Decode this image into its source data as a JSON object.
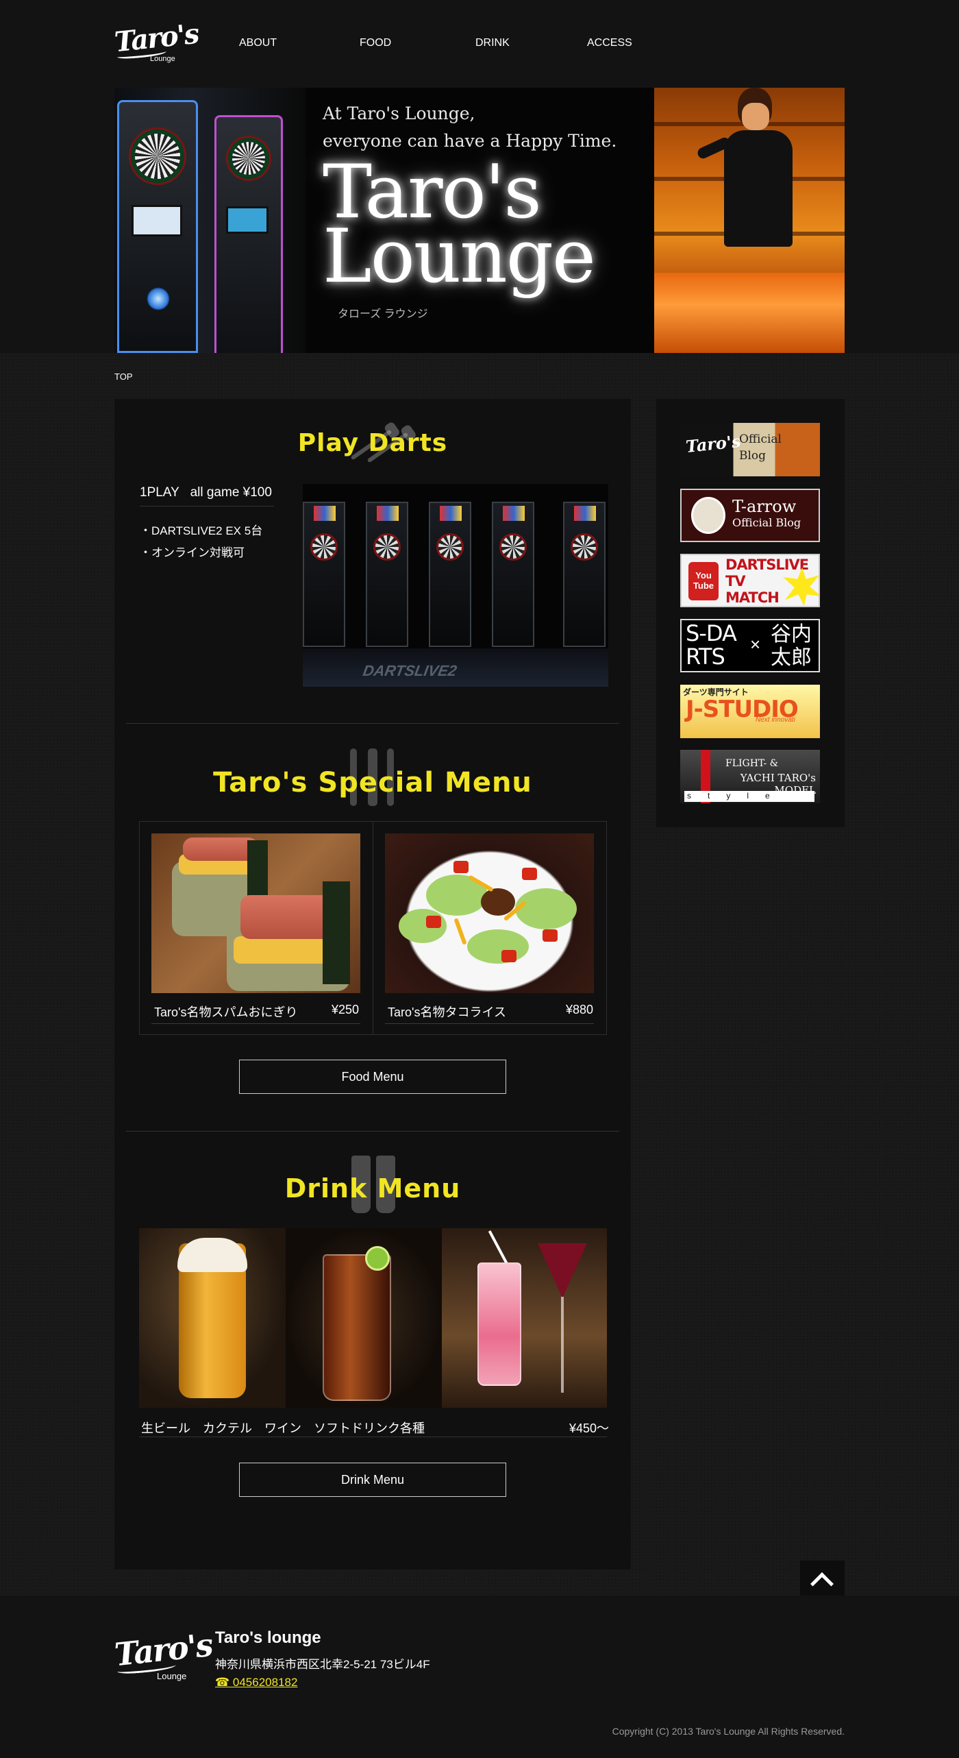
{
  "header": {
    "logo_text": "Taro's",
    "logo_sub": "Lounge",
    "nav": [
      {
        "label": "ABOUT"
      },
      {
        "label": "FOOD"
      },
      {
        "label": "DRINK"
      },
      {
        "label": "ACCESS"
      }
    ]
  },
  "hero": {
    "tagline_1": "At Taro's Lounge,",
    "tagline_2": "everyone can have a Happy Time.",
    "title_1": "Taro's",
    "title_2": "Lounge",
    "kana": "タローズ ラウンジ"
  },
  "breadcrumb": "TOP",
  "darts": {
    "title": "Play Darts",
    "price": "1PLAY   all game ¥100",
    "features": [
      "・DARTSLIVE2 EX 5台",
      "・オンライン対戦可"
    ],
    "photo_brand": "DARTSLIVE2"
  },
  "special_menu": {
    "title": "Taro's Special Menu",
    "items": [
      {
        "name": "Taro's名物スパムおにぎり",
        "price": "¥250"
      },
      {
        "name": "Taro's名物タコライス",
        "price": "¥880"
      }
    ],
    "button_label": "Food Menu"
  },
  "drink_menu": {
    "title": "Drink Menu",
    "caption": "生ビール　カクテル　ワイン　ソフトドリンク各種",
    "price": "¥450〜",
    "button_label": "Drink Menu"
  },
  "sidebar": {
    "banners": [
      {
        "logo": "Taro's",
        "text": "Official Blog"
      },
      {
        "title": "T-arrow",
        "subtitle": "Official Blog"
      },
      {
        "badge": "You Tube",
        "text": "DARTSLIVE TV MATCH"
      },
      {
        "left": "S-DA RTS",
        "x": "×",
        "right": "谷内 太郎"
      },
      {
        "top": "ダーツ専門サイト",
        "main": "J-STUDIO",
        "sub": "Next innovati"
      },
      {
        "title": "FLIGHT-  &",
        "subtitle": "YACHI TARO's MODEL",
        "style_word": "style"
      }
    ]
  },
  "footer": {
    "logo_text": "Taro's",
    "logo_sub": "Lounge",
    "name": "Taro's lounge",
    "address": "神奈川県横浜市西区北幸2-5-21 73ビル4F",
    "phone": "☎ 0456208182",
    "copyright": "Copyright (C) 2013 Taro's Lounge All Rights Reserved."
  },
  "colors": {
    "accent_yellow": "#f1e523",
    "background": "#161616",
    "panel": "#101010"
  },
  "icons": {
    "back_to_top": "chevron-up-icon",
    "darts_watermark": "darts-icon",
    "menu_watermark": "cutlery-icon",
    "drink_watermark": "glasses-icon"
  }
}
